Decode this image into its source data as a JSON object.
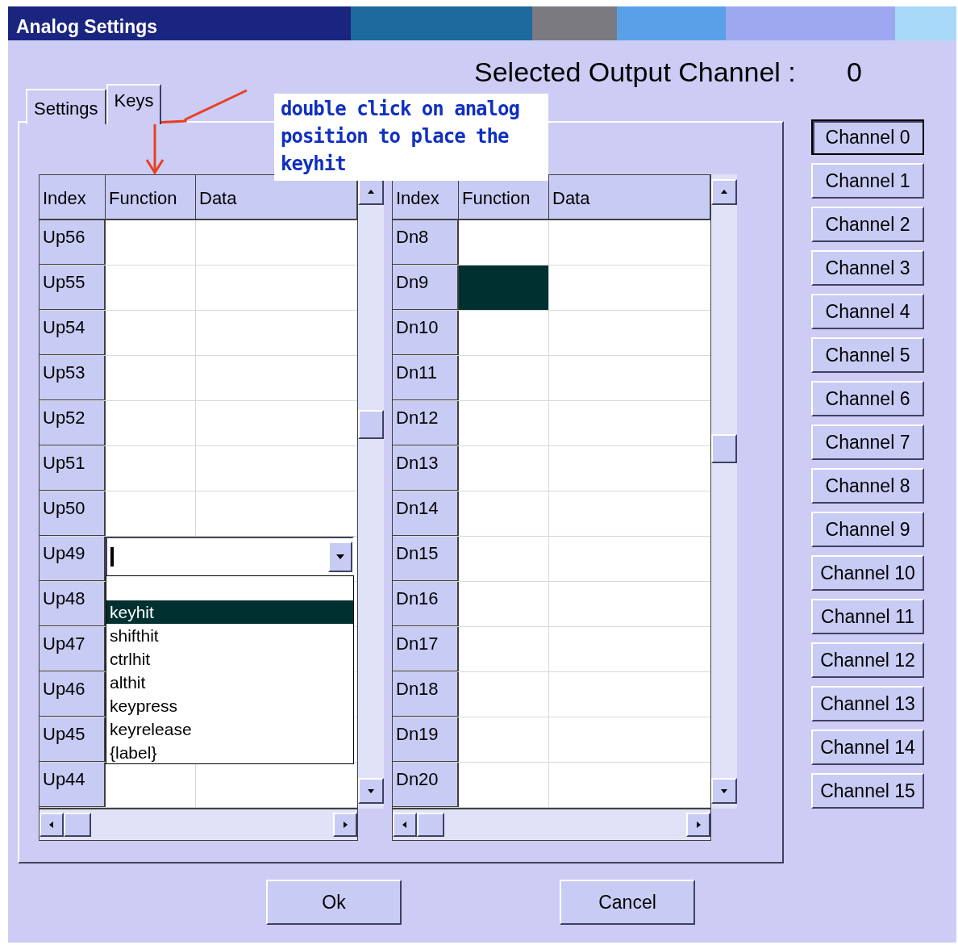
{
  "window": {
    "title": "Analog Settings"
  },
  "selected_channel": {
    "label": "Selected Output Channel :",
    "value": "0"
  },
  "tabs": [
    {
      "label": "Settings",
      "selected": false
    },
    {
      "label": "Keys",
      "selected": true
    }
  ],
  "note": "double click on analog position to place the keyhit",
  "grids": [
    {
      "columns": [
        "Index",
        "Function",
        "Data"
      ],
      "rows": [
        {
          "index": "Up56"
        },
        {
          "index": "Up55"
        },
        {
          "index": "Up54"
        },
        {
          "index": "Up53"
        },
        {
          "index": "Up52"
        },
        {
          "index": "Up51"
        },
        {
          "index": "Up50"
        },
        {
          "index": "Up49",
          "editor": {
            "options": [
              {
                "label": "keyhit",
                "selected": true
              },
              {
                "label": "shifthit",
                "selected": false
              },
              {
                "label": "ctrlhit",
                "selected": false
              },
              {
                "label": "althit",
                "selected": false
              },
              {
                "label": "keypress",
                "selected": false
              },
              {
                "label": "keyrelease",
                "selected": false
              },
              {
                "label": "{label}",
                "selected": false
              }
            ]
          }
        },
        {
          "index": "Up48"
        },
        {
          "index": "Up47"
        },
        {
          "index": "Up46"
        },
        {
          "index": "Up45"
        },
        {
          "index": "Up44"
        }
      ]
    },
    {
      "columns": [
        "Index",
        "Function",
        "Data"
      ],
      "rows": [
        {
          "index": "Dn8",
          "selected": false
        },
        {
          "index": "Dn9",
          "selected": true
        },
        {
          "index": "Dn10",
          "selected": false
        },
        {
          "index": "Dn11",
          "selected": false
        },
        {
          "index": "Dn12",
          "selected": false
        },
        {
          "index": "Dn13",
          "selected": false
        },
        {
          "index": "Dn14",
          "selected": false
        },
        {
          "index": "Dn15",
          "selected": false
        },
        {
          "index": "Dn16",
          "selected": false
        },
        {
          "index": "Dn17",
          "selected": false
        },
        {
          "index": "Dn18",
          "selected": false
        },
        {
          "index": "Dn19",
          "selected": false
        },
        {
          "index": "Dn20",
          "selected": false
        }
      ]
    }
  ],
  "channels": [
    {
      "label": "Channel 0",
      "selected": true
    },
    {
      "label": "Channel 1",
      "selected": false
    },
    {
      "label": "Channel 2",
      "selected": false
    },
    {
      "label": "Channel 3",
      "selected": false
    },
    {
      "label": "Channel 4",
      "selected": false
    },
    {
      "label": "Channel 5",
      "selected": false
    },
    {
      "label": "Channel 6",
      "selected": false
    },
    {
      "label": "Channel 7",
      "selected": false
    },
    {
      "label": "Channel 8",
      "selected": false
    },
    {
      "label": "Channel 9",
      "selected": false
    },
    {
      "label": "Channel 10",
      "selected": false
    },
    {
      "label": "Channel 11",
      "selected": false
    },
    {
      "label": "Channel 12",
      "selected": false
    },
    {
      "label": "Channel 13",
      "selected": false
    },
    {
      "label": "Channel 14",
      "selected": false
    },
    {
      "label": "Channel 15",
      "selected": false
    }
  ],
  "buttons": [
    "Ok",
    "Cancel"
  ]
}
